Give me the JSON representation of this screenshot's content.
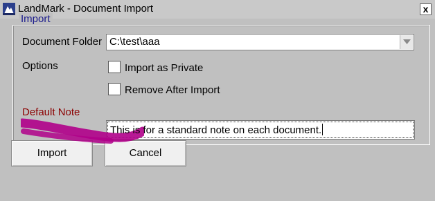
{
  "window": {
    "title": "LandMark - Document Import",
    "close_glyph": "x",
    "icon": "landmark-app-icon"
  },
  "group": {
    "title": "Import"
  },
  "fields": {
    "document_folder_label": "Document Folder",
    "document_folder_value": "C:\\test\\aaa",
    "options_label": "Options",
    "import_private_label": "Import as Private",
    "import_private_checked": false,
    "remove_after_label": "Remove After Import",
    "remove_after_checked": false,
    "default_note_label": "Default Note",
    "default_note_value": "This is for a standard note on each document."
  },
  "buttons": {
    "import_label": "Import",
    "cancel_label": "Cancel"
  },
  "colors": {
    "window_bg": "#c0c0c0",
    "group_title": "#1a1a8c",
    "highlight_marker": "#b0008a"
  }
}
